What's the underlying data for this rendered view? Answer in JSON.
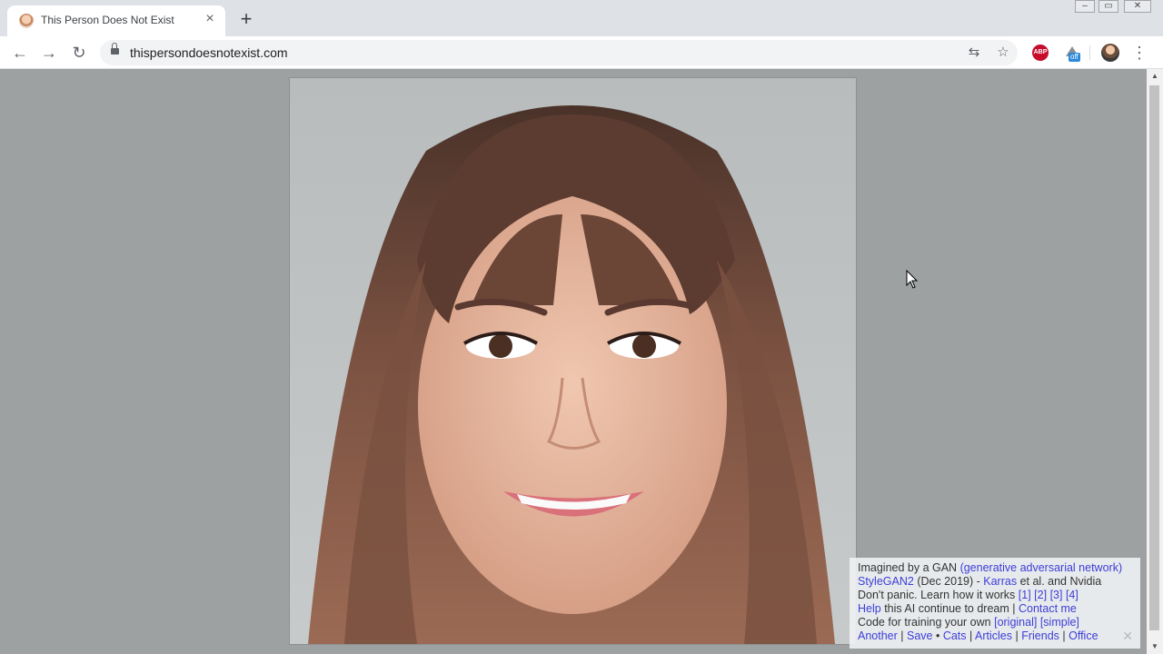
{
  "browser": {
    "tab": {
      "title": "This Person Does Not Exist",
      "close_glyph": "×"
    },
    "new_tab_glyph": "+",
    "window_controls": {
      "minimize": "–",
      "maximize": "▭",
      "close": "✕"
    },
    "nav": {
      "back": "←",
      "forward": "→",
      "reload": "↻"
    },
    "omnibox": {
      "url": "thispersondoesnotexist.com"
    },
    "icons": {
      "translate": "⇆",
      "bookmark": "☆",
      "adblock": "ABP",
      "off_badge": "off",
      "menu": "⋮"
    }
  },
  "page": {
    "background": "#9da1a1",
    "image": {
      "subject": "generated-face"
    },
    "info": {
      "line1": {
        "text": "Imagined by a GAN ",
        "link": "(generative adversarial network)"
      },
      "line2": {
        "link1": "StyleGAN2",
        "text1": " (Dec 2019) - ",
        "link2": "Karras",
        "text2": " et al. and Nvidia"
      },
      "line3": {
        "text": "Don't panic. Learn how it works ",
        "links": [
          "[1]",
          "[2]",
          "[3]",
          "[4]"
        ]
      },
      "line4": {
        "link1": "Help",
        "text1": " this AI continue to dream | ",
        "link2": "Contact me"
      },
      "line5": {
        "text": "Code for training your own ",
        "links": [
          "[original]",
          "[simple]"
        ]
      },
      "line6": {
        "links": [
          "Another",
          "Save",
          "Cats",
          "Articles",
          "Friends",
          "Office"
        ],
        "sep_bullet": " • ",
        "sep_bar": " | "
      },
      "close_glyph": "✕"
    }
  },
  "colors": {
    "link": "#3d3dd8",
    "abp_red": "#c70d2c"
  }
}
